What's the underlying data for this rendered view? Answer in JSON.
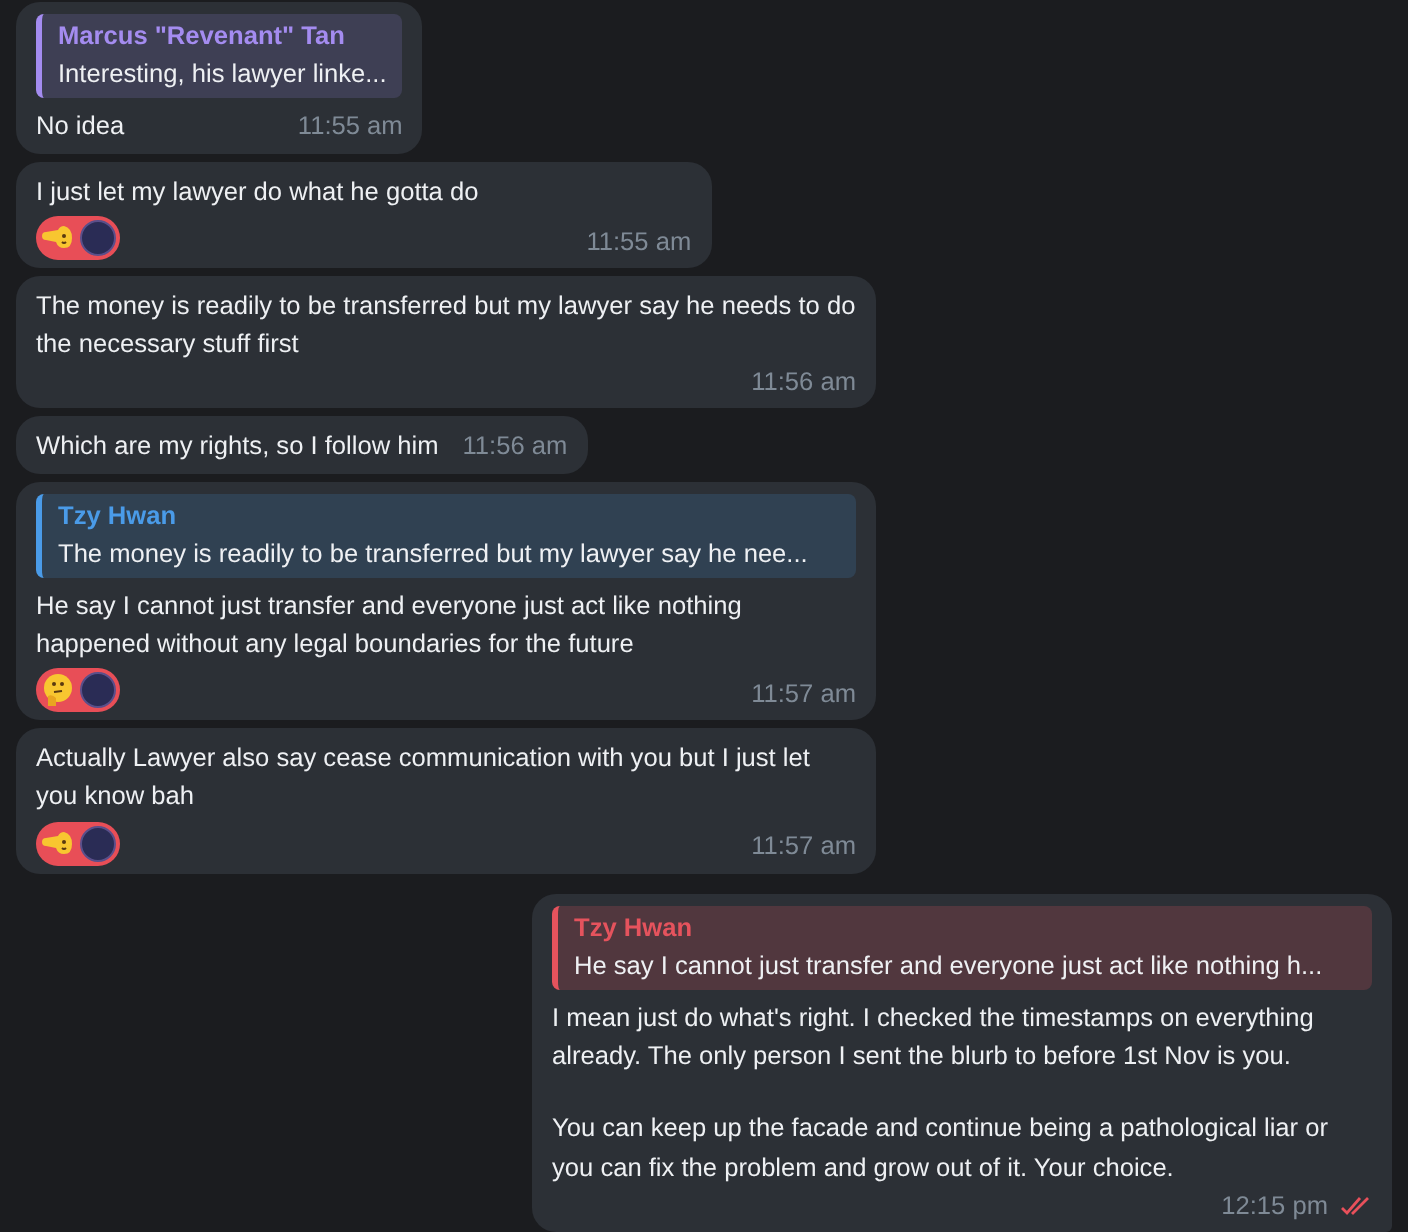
{
  "messages": [
    {
      "outgoing": false,
      "reply": {
        "name": "Marcus \"Revenant\" Tan",
        "text": "Interesting, his lawyer linke...",
        "color": "#a48cf0"
      },
      "paragraphs": [
        "No idea"
      ],
      "time": "11:55 am"
    },
    {
      "outgoing": false,
      "paragraphs": [
        "I just let my lawyer do what he gotta do"
      ],
      "reaction": {
        "kind": "pointing"
      },
      "time": "11:55 am"
    },
    {
      "outgoing": false,
      "paragraphs": [
        "The money is readily to be transferred but my lawyer say he needs to do the necessary stuff first"
      ],
      "time": "11:56 am"
    },
    {
      "outgoing": false,
      "paragraphs": [
        "Which are my rights, so I follow him"
      ],
      "time": "11:56 am"
    },
    {
      "outgoing": false,
      "reply": {
        "name": "Tzy Hwan",
        "text": "The money is readily to be transferred but my lawyer say he nee...",
        "color": "#4a9be8"
      },
      "paragraphs": [
        "He say I cannot just transfer and everyone just act like nothing happened without any legal boundaries for the future"
      ],
      "reaction": {
        "kind": "thinking"
      },
      "time": "11:57 am"
    },
    {
      "outgoing": false,
      "paragraphs": [
        "Actually Lawyer also say cease communication with you but I just let you know bah"
      ],
      "reaction": {
        "kind": "pointing"
      },
      "time": "11:57 am"
    },
    {
      "outgoing": true,
      "reply": {
        "name": "Tzy Hwan",
        "text": "He say I cannot just transfer and everyone just act like nothing h...",
        "color": "#e5535d"
      },
      "paragraphs": [
        "I mean just do what's right. I checked the timestamps on everything already. The only person I sent the blurb to before 1st Nov is you.",
        "You can keep up the facade and continue being a pathological liar or you can fix the problem and grow out of it. Your choice."
      ],
      "time": "12:15 pm",
      "read": true
    }
  ]
}
